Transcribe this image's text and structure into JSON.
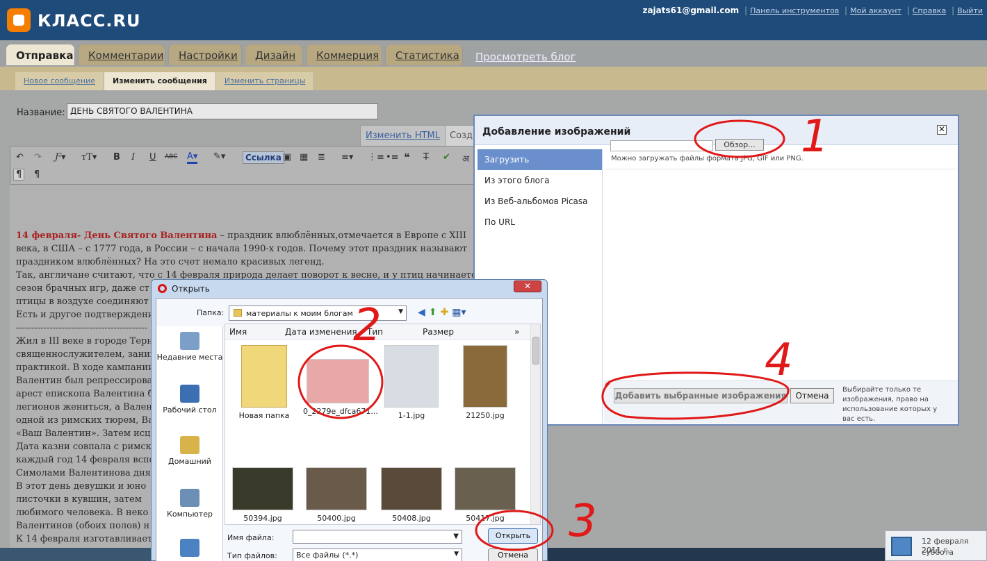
{
  "header": {
    "brand": "КЛАСС.RU",
    "user_email": "zajats61@gmail.com",
    "links": [
      "Панель инструментов",
      "Мой аккаунт",
      "Справка",
      "Выйти"
    ]
  },
  "tabs": [
    "Отправка",
    "Комментарии",
    "Настройки",
    "Дизайн",
    "Коммерция",
    "Статистика"
  ],
  "view_blog": "Просмотреть блог",
  "subtabs": [
    "Новое сообщение",
    "Изменить сообщения",
    "Изменить страницы"
  ],
  "post": {
    "title_label": "Название:",
    "title_value": "ДЕНЬ СВЯТОГО ВАЛЕНТИНА",
    "edit_html": "Изменить HTML",
    "compose": "Созд"
  },
  "toolbar": {
    "link_label": "Ссылка"
  },
  "editor": {
    "lines": [
      {
        "red": "14 февраля-  День Святого Валентина",
        "rest": " – праздник влюблённых,отмечается в Европе с XIII"
      },
      {
        "red": "",
        "rest": "века, в США – с 1777 года, в России – с начала 1990-х годов. Почему этот  праздник называют"
      },
      {
        "red": "",
        "rest": "праздником   влюблённых? На это счет немало красивых легенд."
      },
      {
        "red": "",
        "rest": "Так, англичане считают, что с 14 февраля природа делает поворот к весне, и у птиц начинается"
      },
      {
        "red": "",
        "rest": "сезон брачных игр, даже ст"
      },
      {
        "red": "",
        "rest": "птицы в воздухе соединяют"
      },
      {
        "red": "",
        "rest": "Есть и другое подтверждени"
      },
      {
        "red": "",
        "rest": "-------------------------------------------"
      },
      {
        "red": "",
        "rest": " Жил в III веке в городе Терн"
      },
      {
        "red": "",
        "rest": "священнослужителем, заним"
      },
      {
        "red": "",
        "rest": "практикой. В ходе кампании"
      },
      {
        "red": "",
        "rest": "Валентин был репрессирова"
      },
      {
        "red": "",
        "rest": "арест епископа Валентина б"
      },
      {
        "red": "",
        "rest": "легионов жениться, а Валент"
      },
      {
        "red": "",
        "rest": "одной из римских тюрем, Ва"
      },
      {
        "red": "",
        "rest": "«Ваш Валентин». Затем исце"
      },
      {
        "red": "",
        "rest": "Дата казни совпала с римски"
      },
      {
        "red": "",
        "rest": "каждый год 14 февраля вспо"
      },
      {
        "red": "",
        "rest": "Симолами  Валентинова дня"
      },
      {
        "red": "",
        "rest": "В  этот  день  девушки  и  юно"
      },
      {
        "red": "",
        "rest": "листочки  в  кувшин,  затем"
      },
      {
        "red": "",
        "rest": "любимого человека.  В  неко"
      },
      {
        "red": "",
        "rest": "Валентинов (обоих полов) н"
      },
      {
        "red": "",
        "rest": "К 14 февраля изготавливает"
      }
    ]
  },
  "image_dialog": {
    "title": "Добавление изображений",
    "side": [
      "Загрузить",
      "Из этого блога",
      "Из Веб-альбомов Picasa",
      "По URL"
    ],
    "browse": "Обзор...",
    "formats_note": "Можно загружать файлы формата JPG, GIF или PNG.",
    "add_selected": "Добавить выбранные изображения",
    "cancel": "Отмена",
    "note": "Выбирайте только те изображения, право на использование которых у вас есть."
  },
  "open_dialog": {
    "title": "Открыть",
    "folder_label": "Папка:",
    "folder": "материалы к моим блогам",
    "places": [
      "Недавние места",
      "Рабочий стол",
      "Домашний",
      "Компьютер"
    ],
    "columns": [
      "Имя",
      "Дата изменения",
      "Тип",
      "Размер"
    ],
    "files": [
      "Новая папка",
      "0_2279e_dfca671...",
      "1-1.jpg",
      "21250.jpg",
      "50394.jpg",
      "50400.jpg",
      "50408.jpg",
      "50417.jpg"
    ],
    "filename_label": "Имя файла:",
    "filename_value": "",
    "filetype_label": "Тип файлов:",
    "filetype_value": "Все файлы (*.*)",
    "open_btn": "Открыть",
    "cancel_btn": "Отмена"
  },
  "clock": {
    "date": "12 февраля 2011 г.",
    "day": "суббота"
  },
  "annotations": [
    "1",
    "2",
    "3",
    "4"
  ]
}
